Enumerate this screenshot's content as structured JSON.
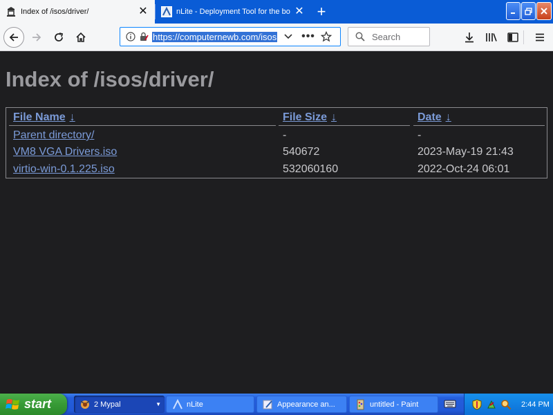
{
  "browser": {
    "tabs": [
      {
        "title": "Index of /isos/driver/",
        "active": true
      },
      {
        "title": "nLite - Deployment Tool for the bo",
        "active": false
      }
    ],
    "url": "https://computernewb.com/isos",
    "search_placeholder": "Search"
  },
  "page": {
    "title": "Index of /isos/driver/",
    "columns": [
      {
        "label": "File Name",
        "sort_arrow": "↓"
      },
      {
        "label": "File Size",
        "sort_arrow": "↓"
      },
      {
        "label": "Date",
        "sort_arrow": "↓"
      }
    ],
    "rows": [
      {
        "name": "Parent directory/",
        "size": "-",
        "date": "-"
      },
      {
        "name": "VM8 VGA Drivers.iso",
        "size": "540672",
        "date": "2023-May-19 21:43"
      },
      {
        "name": "virtio-win-0.1.225.iso",
        "size": "532060160",
        "date": "2022-Oct-24 06:01"
      }
    ]
  },
  "taskbar": {
    "start_label": "start",
    "tasks": [
      {
        "label": "2 Mypal",
        "icon": "mypal-icon"
      },
      {
        "label": "nLite",
        "icon": "nlite-icon"
      },
      {
        "label": "Appearance an...",
        "icon": "appearance-icon"
      },
      {
        "label": "untitled - Paint",
        "icon": "paint-icon"
      }
    ],
    "clock": "2:44 PM"
  },
  "colors": {
    "page_background": "#1e1e20",
    "link": "#7b9bd8",
    "title_bar": "#0a5cd6"
  }
}
